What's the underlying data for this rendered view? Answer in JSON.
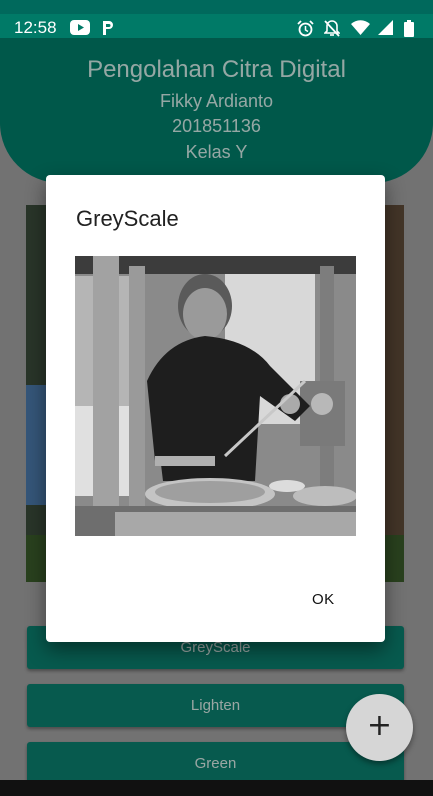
{
  "status_bar": {
    "time": "12:58",
    "icons": [
      "youtube-icon",
      "parking-icon",
      "alarm-icon",
      "notifications-off-icon",
      "wifi-icon",
      "signal-icon",
      "battery-icon"
    ]
  },
  "header": {
    "title": "Pengolahan Citra Digital",
    "name": "Fikky Ardianto",
    "id": "201851136",
    "class": "Kelas Y"
  },
  "buttons": [
    {
      "label": "GreyScale"
    },
    {
      "label": "Lighten"
    },
    {
      "label": "Green"
    }
  ],
  "fab": {
    "label": "+"
  },
  "dialog": {
    "title": "GreyScale",
    "ok_label": "OK"
  },
  "colors": {
    "primary": "#007a67",
    "status_bar": "#007a67",
    "button": "#0b7d6d",
    "fab": "#d6d6d6",
    "dialog_bg": "#ffffff"
  }
}
